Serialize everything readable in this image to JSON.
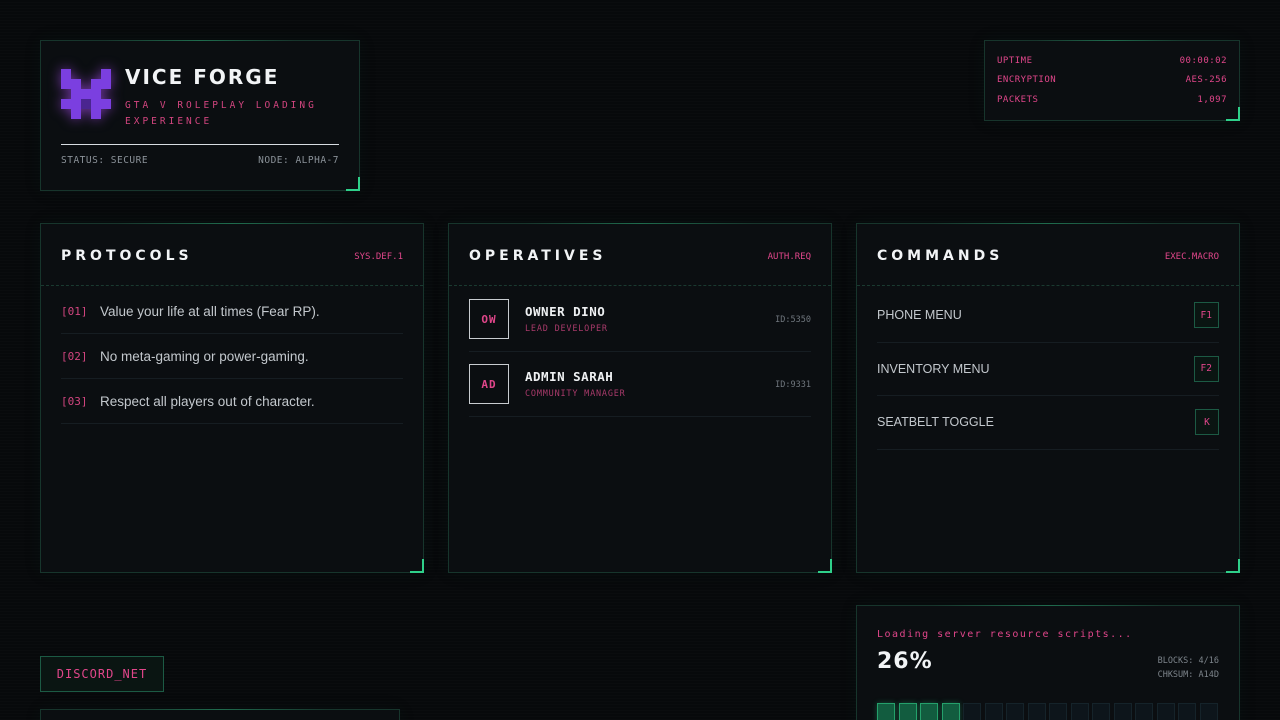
{
  "brand": {
    "title": "VICE FORGE",
    "subtitle": "GTA V ROLEPLAY LOADING EXPERIENCE",
    "status": "STATUS: SECURE",
    "node": "NODE: ALPHA-7",
    "logo_icon": "pixel-x-logo-icon",
    "logo_color": "#7b3fe0"
  },
  "stats": {
    "items": [
      {
        "label": "UPTIME",
        "value": "00:00:02"
      },
      {
        "label": "ENCRYPTION",
        "value": "AES-256"
      },
      {
        "label": "PACKETS",
        "value": "1,097"
      }
    ]
  },
  "protocols": {
    "title": "PROTOCOLS",
    "tag": "SYS.DEF.1",
    "items": [
      {
        "num": "[01]",
        "text": "Value your life at all times (Fear RP)."
      },
      {
        "num": "[02]",
        "text": "No meta-gaming or power-gaming."
      },
      {
        "num": "[03]",
        "text": "Respect all players out of character."
      }
    ]
  },
  "operatives": {
    "title": "OPERATIVES",
    "tag": "AUTH.REQ",
    "items": [
      {
        "initials": "OW",
        "name": "OWNER DINO",
        "role": "LEAD DEVELOPER",
        "id": "ID:5350"
      },
      {
        "initials": "AD",
        "name": "ADMIN SARAH",
        "role": "COMMUNITY MANAGER",
        "id": "ID:9331"
      }
    ]
  },
  "commands": {
    "title": "COMMANDS",
    "tag": "EXEC.MACRO",
    "items": [
      {
        "label": "PHONE MENU",
        "key": "F1"
      },
      {
        "label": "INVENTORY MENU",
        "key": "F2"
      },
      {
        "label": "SEATBELT TOGGLE",
        "key": "K"
      }
    ]
  },
  "discord": {
    "label": "DISCORD_NET"
  },
  "loader": {
    "status_text": "Loading server resource scripts...",
    "percent": "26%",
    "blocks_label": "BLOCKS: 4/16",
    "checksum_label": "CHKSUM: A14D",
    "blocks_total": 16,
    "blocks_filled": 4
  },
  "colors": {
    "accent_pink": "#e0468a",
    "accent_green": "#2fd08a",
    "background": "#07090b"
  }
}
